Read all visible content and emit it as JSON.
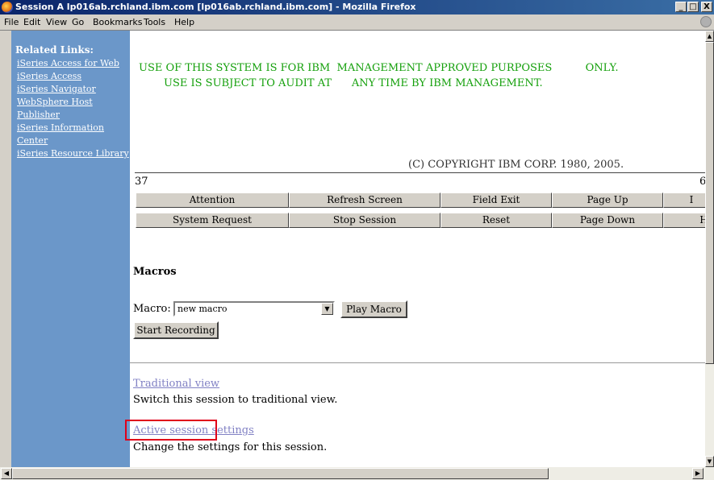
{
  "window": {
    "title": "Session A lp016ab.rchland.ibm.com [lp016ab.rchland.ibm.com] - Mozilla Firefox",
    "minimize": "_",
    "maximize": "□",
    "close": "X"
  },
  "menu": [
    "File",
    "Edit",
    "View",
    "Go",
    "Bookmarks",
    "Tools",
    "Help"
  ],
  "sidebar": {
    "heading": "Related Links:",
    "links": [
      "iSeries Access for Web",
      "iSeries Access",
      "iSeries Navigator",
      "WebSphere Host",
      "Publisher",
      "iSeries Information",
      "Center",
      "iSeries Resource Library"
    ]
  },
  "terminal": {
    "notice_line1": "USE OF THIS SYSTEM IS FOR IBM  MANAGEMENT APPROVED PURPOSES          ONLY.",
    "notice_line2": "USE IS SUBJECT TO AUDIT AT      ANY TIME BY IBM MANAGEMENT.",
    "copyright": "(C) COPYRIGHT IBM CORP. 1980, 2005.",
    "row_left": "37",
    "row_right": "6",
    "text_color": "#15a00c"
  },
  "keys": {
    "row1": [
      "Attention",
      "Refresh Screen",
      "Field Exit",
      "Page Up",
      "I"
    ],
    "row2": [
      "System Request",
      "Stop Session",
      "Reset",
      "Page Down",
      "Ho"
    ]
  },
  "macros": {
    "heading": "Macros",
    "label": "Macro:",
    "selected": "new macro",
    "play_label": "Play Macro",
    "record_label": "Start Recording"
  },
  "links": {
    "traditional": "Traditional view",
    "traditional_desc": "Switch this session to traditional view.",
    "settings": "Active session settings",
    "settings_desc": "Change the settings for this session."
  },
  "colors": {
    "sidebar": "#6b97c9",
    "highlight": "#e0001a",
    "link": "#8181c4"
  }
}
